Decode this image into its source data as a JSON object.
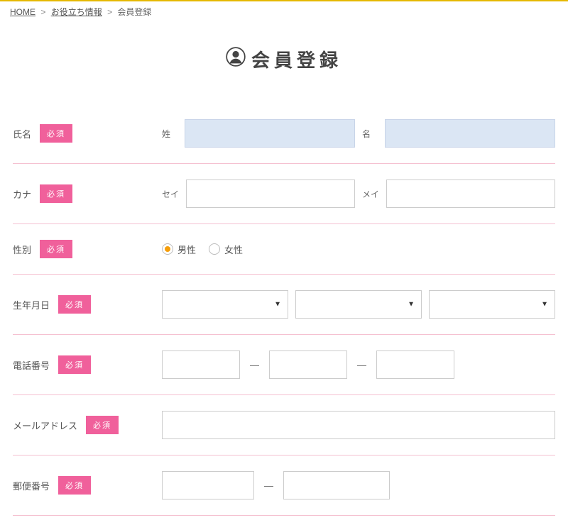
{
  "breadcrumb": {
    "home": "HOME",
    "mid": "お役立ち情報",
    "current": "会員登録"
  },
  "page_title": "会員登録",
  "required_label": "必須",
  "rows": {
    "name": {
      "label": "氏名",
      "sub1": "姓",
      "sub2": "名"
    },
    "kana": {
      "label": "カナ",
      "sub1": "セイ",
      "sub2": "メイ"
    },
    "gender": {
      "label": "性別",
      "opt_male": "男性",
      "opt_female": "女性"
    },
    "birth": {
      "label": "生年月日"
    },
    "tel": {
      "label": "電話番号",
      "dash": "—"
    },
    "email": {
      "label": "メールアドレス"
    },
    "zip": {
      "label": "郵便番号",
      "dash": "—"
    }
  }
}
